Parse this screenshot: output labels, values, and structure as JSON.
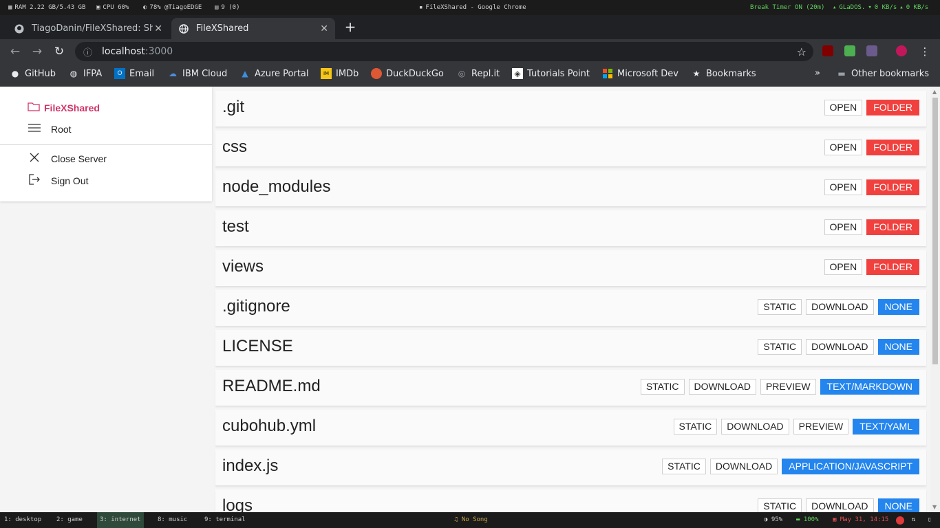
{
  "system_bar": {
    "ram": "RAM 2.22 GB/5.43 GB",
    "cpu": "CPU 60%",
    "battery_user": "78% @TiagoEDGE",
    "notifications": "9 (0)",
    "window_title": "FileXShared - Google Chrome",
    "break_timer": "Break Timer ON (20m)",
    "network_name": "GLaDOS.",
    "net_down": "0 KB/s",
    "net_up": "0 KB/s"
  },
  "browser": {
    "tabs": [
      {
        "title": "TiagoDanin/FileXShared: Sh",
        "icon": "github-icon"
      },
      {
        "title": "FileXShared",
        "icon": "globe-icon"
      }
    ],
    "url_host": "localhost",
    "url_port": ":3000",
    "bookmarks": [
      {
        "label": "GitHub",
        "icon": "github-icon"
      },
      {
        "label": "IFPA",
        "icon": "globe-icon"
      },
      {
        "label": "Email",
        "icon": "outlook-icon"
      },
      {
        "label": "IBM Cloud",
        "icon": "ibm-cloud-icon"
      },
      {
        "label": "Azure Portal",
        "icon": "azure-icon"
      },
      {
        "label": "IMDb",
        "icon": "imdb-icon"
      },
      {
        "label": "DuckDuckGo",
        "icon": "duckduckgo-icon"
      },
      {
        "label": "Repl.it",
        "icon": "replit-icon"
      },
      {
        "label": "Tutorials Point",
        "icon": "tutorialspoint-icon"
      },
      {
        "label": "Microsoft Dev",
        "icon": "microsoft-icon"
      },
      {
        "label": "Bookmarks",
        "icon": "star-icon"
      }
    ],
    "more": "»",
    "other_bookmarks": "Other bookmarks"
  },
  "sidebar": {
    "brand": "FileXShared",
    "root": "Root",
    "close_server": "Close Server",
    "sign_out": "Sign Out"
  },
  "files": [
    {
      "name": ".git",
      "actions": [
        "OPEN"
      ],
      "type": "FOLDER",
      "type_color": "red"
    },
    {
      "name": "css",
      "actions": [
        "OPEN"
      ],
      "type": "FOLDER",
      "type_color": "red"
    },
    {
      "name": "node_modules",
      "actions": [
        "OPEN"
      ],
      "type": "FOLDER",
      "type_color": "red"
    },
    {
      "name": "test",
      "actions": [
        "OPEN"
      ],
      "type": "FOLDER",
      "type_color": "red"
    },
    {
      "name": "views",
      "actions": [
        "OPEN"
      ],
      "type": "FOLDER",
      "type_color": "red"
    },
    {
      "name": ".gitignore",
      "actions": [
        "STATIC",
        "DOWNLOAD"
      ],
      "type": "NONE",
      "type_color": "blue"
    },
    {
      "name": "LICENSE",
      "actions": [
        "STATIC",
        "DOWNLOAD"
      ],
      "type": "NONE",
      "type_color": "blue"
    },
    {
      "name": "README.md",
      "actions": [
        "STATIC",
        "DOWNLOAD",
        "PREVIEW"
      ],
      "type": "TEXT/MARKDOWN",
      "type_color": "blue"
    },
    {
      "name": "cubohub.yml",
      "actions": [
        "STATIC",
        "DOWNLOAD",
        "PREVIEW"
      ],
      "type": "TEXT/YAML",
      "type_color": "blue"
    },
    {
      "name": "index.js",
      "actions": [
        "STATIC",
        "DOWNLOAD"
      ],
      "type": "APPLICATION/JAVASCRIPT",
      "type_color": "blue"
    },
    {
      "name": "logs",
      "actions": [
        "STATIC",
        "DOWNLOAD"
      ],
      "type": "NONE",
      "type_color": "blue"
    }
  ],
  "taskbar": {
    "workspaces": [
      "1: desktop",
      "2: game",
      "3: internet",
      "8: music",
      "9: terminal"
    ],
    "song": "No Song",
    "brightness": "95%",
    "battery": "100%",
    "date": "May 31, 14:15"
  },
  "colors": {
    "brand": "#d0346a",
    "folder_tag": "#f0413e",
    "type_tag": "#2385ed"
  }
}
